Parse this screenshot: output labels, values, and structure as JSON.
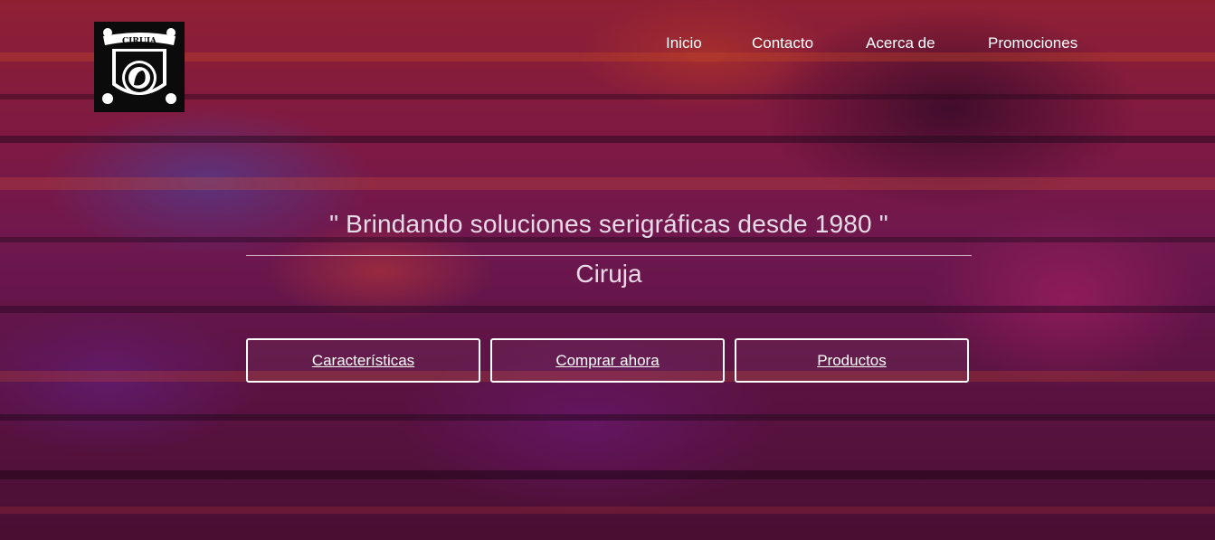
{
  "logo": {
    "text": "CIRUJA",
    "alt": "Ciruja logo"
  },
  "nav": {
    "items": [
      {
        "label": "Inicio"
      },
      {
        "label": "Contacto"
      },
      {
        "label": "Acerca de"
      },
      {
        "label": "Promociones"
      }
    ]
  },
  "hero": {
    "tagline": "\" Brindando soluciones serigráficas desde 1980 \"",
    "brand": "Ciruja",
    "buttons": [
      {
        "label": "Características"
      },
      {
        "label": "Comprar ahora"
      },
      {
        "label": "Productos"
      }
    ]
  },
  "colors": {
    "text": "#ffffff",
    "tagline": "#e6dbe6",
    "background_base": "#7a1e5a",
    "button_border": "#ffffff"
  }
}
